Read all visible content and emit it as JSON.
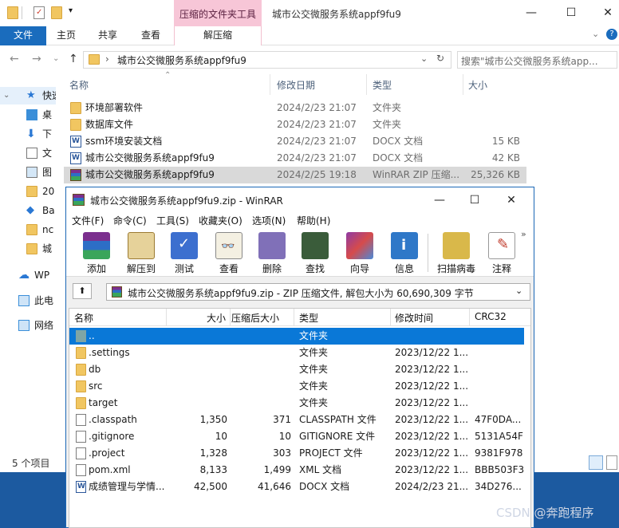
{
  "colors": {
    "accent": "#1a6cbd",
    "context_tab": "#f7c6d7",
    "selection": "#0a78d7",
    "desktop": "#1c5aa0"
  },
  "explorer": {
    "window_title": "城市公交微服务系统appf9fu9",
    "context_tab_title": "压缩的文件夹工具",
    "tabs": {
      "file": "文件",
      "home": "主页",
      "share": "共享",
      "view": "查看",
      "extract": "解压缩"
    },
    "breadcrumb": "城市公交微服务系统appf9fu9",
    "search_placeholder": "搜索\"城市公交微服务系统app...",
    "nav_items": [
      {
        "label": "快速",
        "icon": "star-icon"
      },
      {
        "label": "桌",
        "icon": "desktop-icon"
      },
      {
        "label": "下",
        "icon": "download-icon"
      },
      {
        "label": "文",
        "icon": "document-icon"
      },
      {
        "label": "图",
        "icon": "picture-icon"
      },
      {
        "label": "20",
        "icon": "folder-icon"
      },
      {
        "label": "Ba",
        "icon": "app-icon"
      },
      {
        "label": "nc",
        "icon": "folder-icon"
      },
      {
        "label": "城",
        "icon": "folder-icon"
      },
      {
        "label": "WP",
        "icon": "cloud-icon"
      },
      {
        "label": "此电",
        "icon": "computer-icon"
      },
      {
        "label": "网络",
        "icon": "network-icon"
      }
    ],
    "columns": {
      "name": "名称",
      "date": "修改日期",
      "type": "类型",
      "size": "大小"
    },
    "files": [
      {
        "name": "环境部署软件",
        "date": "2024/2/23 21:07",
        "type": "文件夹",
        "size": "",
        "icon": "folder-icon"
      },
      {
        "name": "数据库文件",
        "date": "2024/2/23 21:07",
        "type": "文件夹",
        "size": "",
        "icon": "folder-icon"
      },
      {
        "name": "ssm环境安装文档",
        "date": "2024/2/23 21:07",
        "type": "DOCX 文档",
        "size": "15 KB",
        "icon": "docx-icon"
      },
      {
        "name": "城市公交微服务系统appf9fu9",
        "date": "2024/2/23 21:07",
        "type": "DOCX 文档",
        "size": "42 KB",
        "icon": "docx-icon"
      },
      {
        "name": "城市公交微服务系统appf9fu9",
        "date": "2024/2/25 19:18",
        "type": "WinRAR ZIP 压缩...",
        "size": "25,326 KB",
        "icon": "winrar-icon"
      }
    ],
    "status": "5 个项目"
  },
  "winrar": {
    "title": "城市公交微服务系统appf9fu9.zip - WinRAR",
    "menu": [
      "文件(F)",
      "命令(C)",
      "工具(S)",
      "收藏夹(O)",
      "选项(N)",
      "帮助(H)"
    ],
    "toolbar": [
      {
        "label": "添加",
        "icon": "add-icon"
      },
      {
        "label": "解压到",
        "icon": "extract-icon"
      },
      {
        "label": "测试",
        "icon": "test-icon"
      },
      {
        "label": "查看",
        "icon": "view-icon"
      },
      {
        "label": "删除",
        "icon": "delete-icon"
      },
      {
        "label": "查找",
        "icon": "find-icon"
      },
      {
        "label": "向导",
        "icon": "wizard-icon"
      },
      {
        "label": "信息",
        "icon": "info-icon"
      },
      {
        "label": "扫描病毒",
        "icon": "scan-icon"
      },
      {
        "label": "注释",
        "icon": "comment-icon"
      }
    ],
    "path": "城市公交微服务系统appf9fu9.zip - ZIP 压缩文件, 解包大小为 60,690,309 字节",
    "columns": {
      "name": "名称",
      "size": "大小",
      "packed": "压缩后大小",
      "type": "类型",
      "modified": "修改时间",
      "crc": "CRC32"
    },
    "rows": [
      {
        "name": "..",
        "size": "",
        "packed": "",
        "type": "文件夹",
        "modified": "",
        "crc": "",
        "icon": "folder-icon"
      },
      {
        "name": ".settings",
        "size": "",
        "packed": "",
        "type": "文件夹",
        "modified": "2023/12/22 1...",
        "crc": "",
        "icon": "folder-icon"
      },
      {
        "name": "db",
        "size": "",
        "packed": "",
        "type": "文件夹",
        "modified": "2023/12/22 1...",
        "crc": "",
        "icon": "folder-icon"
      },
      {
        "name": "src",
        "size": "",
        "packed": "",
        "type": "文件夹",
        "modified": "2023/12/22 1...",
        "crc": "",
        "icon": "folder-icon"
      },
      {
        "name": "target",
        "size": "",
        "packed": "",
        "type": "文件夹",
        "modified": "2023/12/22 1...",
        "crc": "",
        "icon": "folder-icon"
      },
      {
        "name": ".classpath",
        "size": "1,350",
        "packed": "371",
        "type": "CLASSPATH 文件",
        "modified": "2023/12/22 1...",
        "crc": "47F0DA...",
        "icon": "file-icon"
      },
      {
        "name": ".gitignore",
        "size": "10",
        "packed": "10",
        "type": "GITIGNORE 文件",
        "modified": "2023/12/22 1...",
        "crc": "5131A54F",
        "icon": "file-icon"
      },
      {
        "name": ".project",
        "size": "1,328",
        "packed": "303",
        "type": "PROJECT 文件",
        "modified": "2023/12/22 1...",
        "crc": "9381F978",
        "icon": "file-icon"
      },
      {
        "name": "pom.xml",
        "size": "8,133",
        "packed": "1,499",
        "type": "XML 文档",
        "modified": "2023/12/22 1...",
        "crc": "BBB503F3",
        "icon": "xml-icon"
      },
      {
        "name": "成绩管理与学情...",
        "size": "42,500",
        "packed": "41,646",
        "type": "DOCX 文档",
        "modified": "2024/2/23 21...",
        "crc": "34D276...",
        "icon": "docx-icon"
      }
    ]
  },
  "watermark": "CSDN @奔跑程序"
}
